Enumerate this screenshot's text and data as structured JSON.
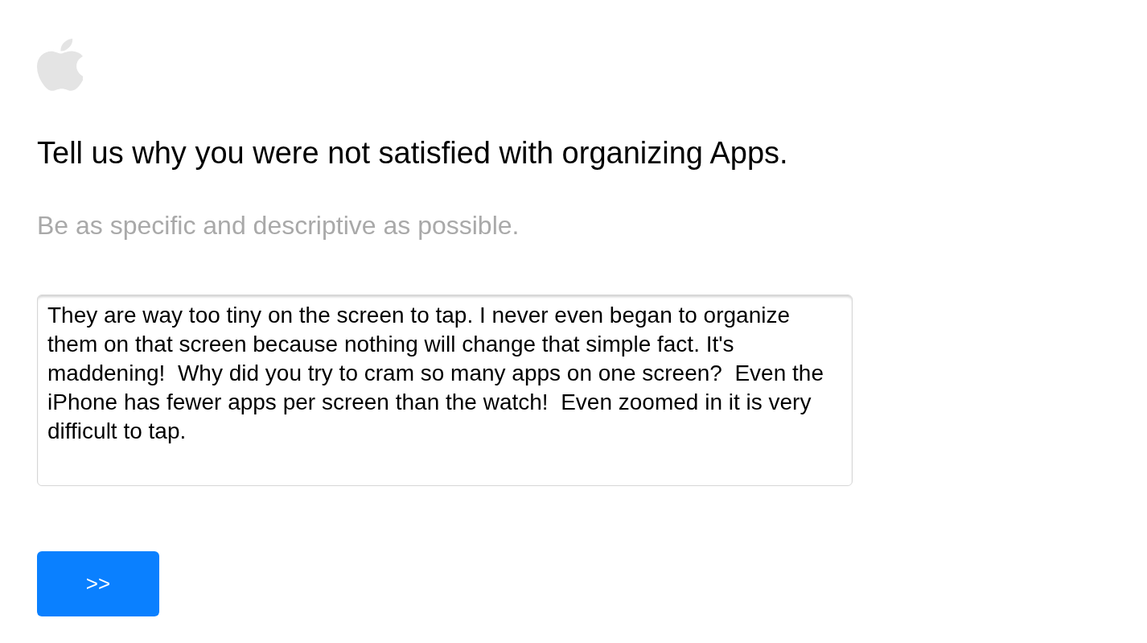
{
  "heading": "Tell us why you were not satisfied with organizing Apps.",
  "subheading": "Be as specific and descriptive as possible.",
  "feedback_field": {
    "value": "They are way too tiny on the screen to tap. I never even began to organize them on that screen because nothing will change that simple fact. It's maddening!  Why did you try to cram so many apps on one screen?  Even the iPhone has fewer apps per screen than the watch!  Even zoomed in it is very difficult to tap."
  },
  "next_button": {
    "label": ">>"
  }
}
